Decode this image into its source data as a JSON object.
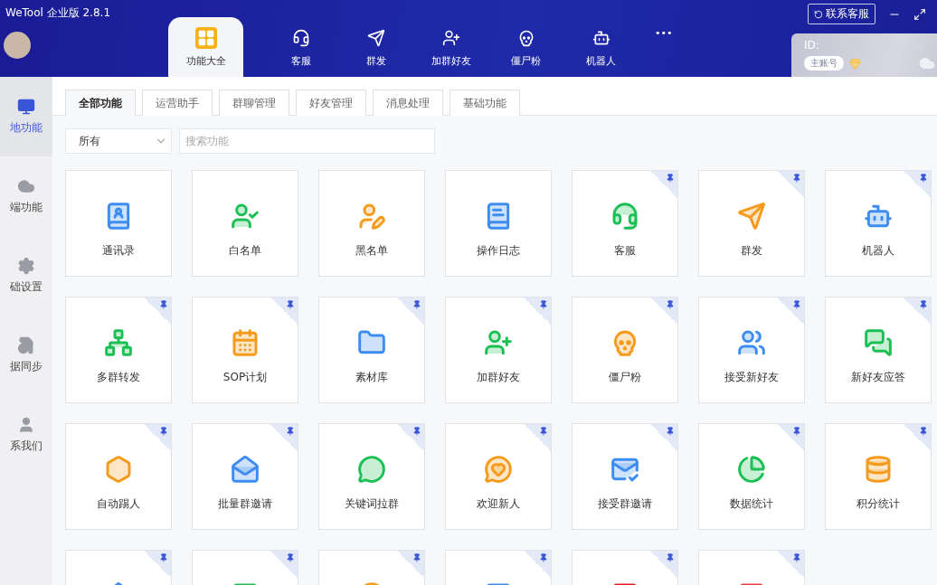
{
  "window": {
    "title": "WeTool 企业版 2.8.1"
  },
  "top_tabs": [
    {
      "label": "功能大全",
      "selected": true
    },
    {
      "label": "客服",
      "selected": false
    },
    {
      "label": "群发",
      "selected": false
    },
    {
      "label": "加群好友",
      "selected": false
    },
    {
      "label": "僵尸粉",
      "selected": false
    },
    {
      "label": "机器人",
      "selected": false
    }
  ],
  "more": "•••",
  "contact_button": "联系客服",
  "account": {
    "id_label": "ID:",
    "badge": "主账号"
  },
  "sidebar": {
    "items": [
      {
        "label": "地功能",
        "selected": true
      },
      {
        "label": "端功能",
        "selected": false
      },
      {
        "label": "础设置",
        "selected": false
      },
      {
        "label": "据同步",
        "selected": false
      },
      {
        "label": "系我们",
        "selected": false
      }
    ]
  },
  "category_tabs": [
    {
      "label": "全部功能",
      "selected": true
    },
    {
      "label": "运营助手",
      "selected": false
    },
    {
      "label": "群聊管理",
      "selected": false
    },
    {
      "label": "好友管理",
      "selected": false
    },
    {
      "label": "消息处理",
      "selected": false
    },
    {
      "label": "基础功能",
      "selected": false
    }
  ],
  "filter": {
    "value": "所有"
  },
  "search": {
    "placeholder": "搜索功能"
  },
  "features": [
    {
      "label": "通讯录",
      "pinned": false
    },
    {
      "label": "白名单",
      "pinned": false
    },
    {
      "label": "黑名单",
      "pinned": false
    },
    {
      "label": "操作日志",
      "pinned": false
    },
    {
      "label": "客服",
      "pinned": true
    },
    {
      "label": "群发",
      "pinned": true
    },
    {
      "label": "机器人",
      "pinned": true
    },
    {
      "label": "多群转发",
      "pinned": true
    },
    {
      "label": "SOP计划",
      "pinned": true
    },
    {
      "label": "素材库",
      "pinned": true
    },
    {
      "label": "加群好友",
      "pinned": true
    },
    {
      "label": "僵尸粉",
      "pinned": true
    },
    {
      "label": "接受新好友",
      "pinned": true
    },
    {
      "label": "新好友应答",
      "pinned": true
    },
    {
      "label": "自动踢人",
      "pinned": true
    },
    {
      "label": "批量群邀请",
      "pinned": true
    },
    {
      "label": "关键词拉群",
      "pinned": true
    },
    {
      "label": "欢迎新人",
      "pinned": true
    },
    {
      "label": "接受群邀请",
      "pinned": true
    },
    {
      "label": "数据统计",
      "pinned": true
    },
    {
      "label": "积分统计",
      "pinned": true
    },
    {
      "pinned": true
    },
    {
      "pinned": true
    },
    {
      "pinned": true
    },
    {
      "pinned": true
    },
    {
      "pinned": true
    },
    {
      "pinned": true
    }
  ]
}
